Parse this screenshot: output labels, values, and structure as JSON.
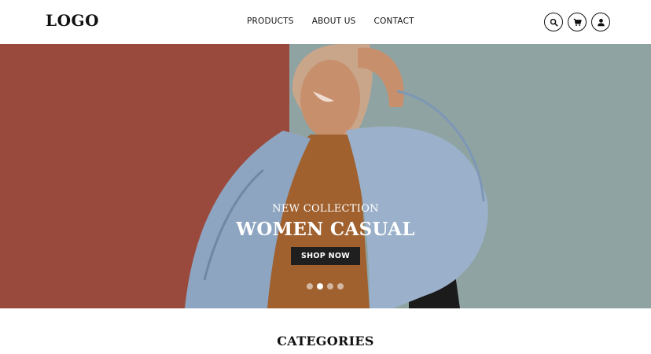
{
  "header": {
    "logo": "LOGO",
    "nav": [
      "PRODUCTS",
      "ABOUT US",
      "CONTACT"
    ],
    "icons": [
      "search-icon",
      "cart-icon",
      "user-icon"
    ]
  },
  "hero": {
    "subtitle": "NEW COLLECTION",
    "title": "WOMEN CASUAL",
    "button_label": "SHOP NOW",
    "slides_total": 4,
    "active_slide": 2
  },
  "categories": {
    "title": "CATEGORIES"
  },
  "colors": {
    "wall_red": "#9a4a3d",
    "wall_teal": "#8fa3a3",
    "button_dark": "#1f1f1f",
    "text": "#111111"
  }
}
